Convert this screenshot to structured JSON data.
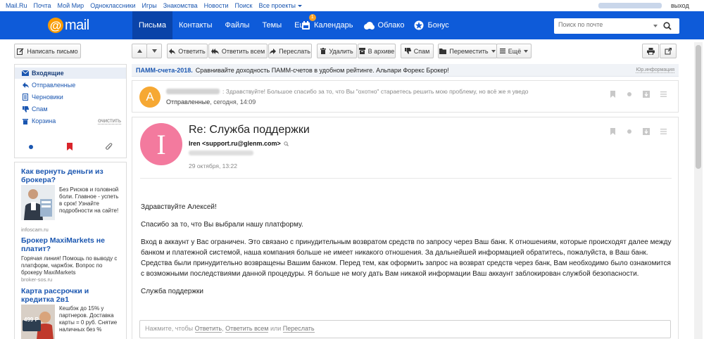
{
  "portal": {
    "links": [
      "Mail.Ru",
      "Почта",
      "Мой Мир",
      "Одноклассники",
      "Игры",
      "Знакомства",
      "Новости",
      "Поиск",
      "Все проекты"
    ],
    "logout": "выход"
  },
  "header": {
    "logo": "mail",
    "logo_at": "@",
    "tabs": [
      {
        "label": "Письма",
        "active": true
      },
      {
        "label": "Контакты"
      },
      {
        "label": "Файлы"
      },
      {
        "label": "Темы"
      },
      {
        "label": "Ещё",
        "badge": "1"
      }
    ],
    "services": [
      "Календарь",
      "Облако",
      "Бонус"
    ],
    "search_placeholder": "Поиск по почте"
  },
  "toolbar": {
    "compose": "Написать письмо",
    "reply": "Ответить",
    "reply_all": "Ответить всем",
    "forward": "Переслать",
    "delete": "Удалить",
    "archive": "В архиве",
    "spam": "Спам",
    "move": "Переместить",
    "more": "Ещё"
  },
  "folders": {
    "items": [
      {
        "label": "Входящие",
        "icon": "inbox-icon"
      },
      {
        "label": "Отправленные",
        "icon": "sent-icon"
      },
      {
        "label": "Черновики",
        "icon": "drafts-icon"
      },
      {
        "label": "Спам",
        "icon": "spam-icon"
      },
      {
        "label": "Корзина",
        "icon": "trash-icon"
      }
    ],
    "clear": "очистить"
  },
  "ads": [
    {
      "title": "Как вернуть деньги из брокера?",
      "body": "Без Рисков и головной боли. Главное - успеть в срок! Узнайте подробности на сайте!",
      "domain": "infoscam.ru"
    },
    {
      "title": "Брокер MaxiMarkets не платит?",
      "body": "Горячая линия! Помощь по выводу с платформ, чаржбэк. Вопрос по брокеру MaxiMarkets",
      "domain": "broker-sos.ru"
    },
    {
      "title": "Карта рассрочки и кредитка 2в1",
      "body": "Кешбэк до 15% у партнеров. Доставка карты = 0 руб. Снятие наличных без %",
      "price": "499 Р"
    }
  ],
  "banner": {
    "title": "ПАММ-счета-2018.",
    "text": "Сравнивайте доходность ПАММ-счетов в удобном рейтинге. Альпари Форекс Брокер!",
    "label": "Юр.информация"
  },
  "collapsed_message": {
    "avatar_letter": "A",
    "preview": ": Здравствуйте! Большое спасибо за то, что Вы \"охотно\" стараетесь решить мою проблему, но всё же я уведо",
    "folder": "Отправленные",
    "date": ", сегодня, 14:09"
  },
  "message": {
    "avatar_letter": "I",
    "subject": "Re: Служба поддержки",
    "from": "Iren <support.ru@glenm.com>",
    "date": "29 октября, 13:22",
    "greeting": "Здравствуйте Алексей!",
    "thanks": "Спасибо за то, что Вы выбрали нашу платформу.",
    "paragraph": "Вход в аккаунт у Вас ограничен. Это связано с принудительным возвратом средств по запросу через Ваш банк. К отношениям, которые происходят далее между банком и платежной системой, наша компания больше не имеет никакого отношения. За дальнейшей информацией обратитесь, пожалуйста, в Ваш банк. Средства были принудительно возвращены Вашим банком. Перед тем, как оформить запрос на возврат средств через банк, Вам необходимо было ознакомится с возможными последствиями данной процедуры. Я больше не могу дать Вам никакой информации Ваш аккаунт заблокирован службой безопасности.",
    "signature": "Служба поддержки"
  },
  "reply_box": {
    "prefix": "Нажмите, чтобы ",
    "reply": "Ответить",
    "sep1": ", ",
    "reply_all": "Ответить всем",
    "sep2": " или ",
    "forward": "Переслать"
  },
  "colors": {
    "header_blue": "#0e5bd9",
    "active_tab": "#0a43a8",
    "link_blue": "#1a56b0",
    "avatar_a": "#f6a833",
    "avatar_i": "#f37a9e"
  }
}
